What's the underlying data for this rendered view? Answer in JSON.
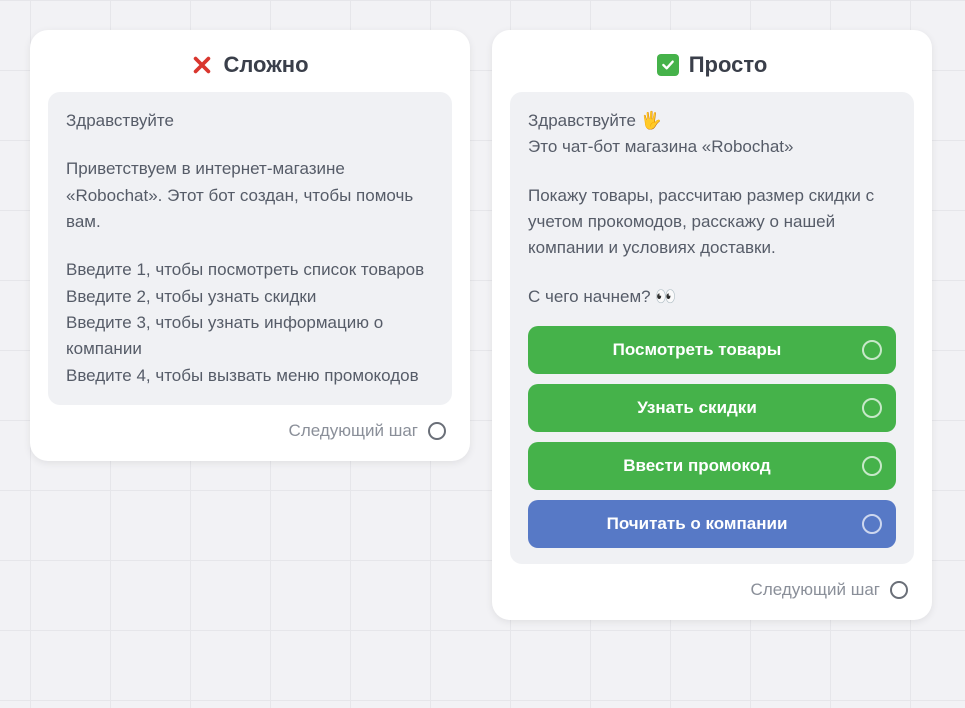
{
  "left": {
    "title": "Сложно",
    "msg": {
      "greet": "Здравствуйте",
      "intro": "Приветствуем в интернет-магазине «Robochat». Этот бот создан, чтобы помочь вам.",
      "opt1": "Введите 1, чтобы посмотреть список товаров",
      "opt2": "Введите 2, чтобы узнать скидки",
      "opt3": "Введите 3, чтобы узнать информацию о компании",
      "opt4": "Введите 4, чтобы вызвать меню промокодов"
    },
    "next": "Следующий шаг"
  },
  "right": {
    "title": "Просто",
    "msg": {
      "greet": "Здравствуйте 🖐",
      "intro": "Это чат-бот магазина «Robochat»",
      "desc": "Покажу товары, рассчитаю размер скидки с учетом прокомодов, расскажу о нашей компании и условиях доставки.",
      "prompt": "С чего начнем? 👀"
    },
    "buttons": {
      "b1": "Посмотреть товары",
      "b2": "Узнать скидки",
      "b3": "Ввести промокод",
      "b4": "Почитать о компании"
    },
    "next": "Следующий шаг"
  }
}
